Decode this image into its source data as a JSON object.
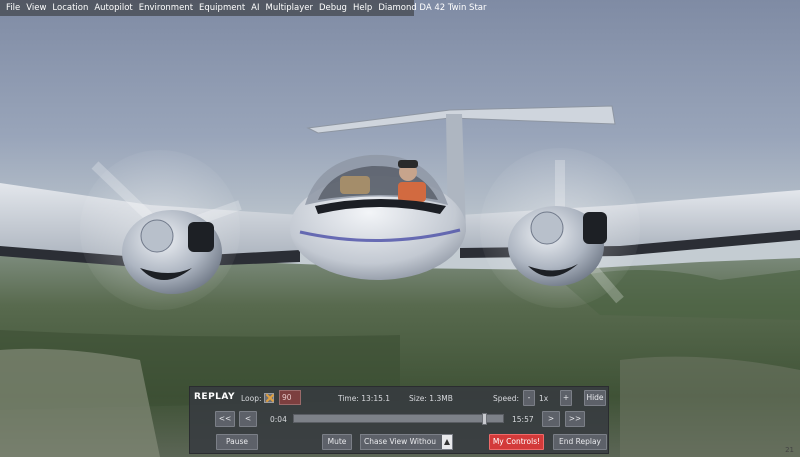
{
  "menu": {
    "items": [
      "File",
      "View",
      "Location",
      "Autopilot",
      "Environment",
      "Equipment",
      "AI",
      "Multiplayer",
      "Debug",
      "Help",
      "Diamond DA 42 Twin Star"
    ]
  },
  "replay": {
    "title": "REPLAY",
    "loop_label": "Loop:",
    "loop_checked": true,
    "loop_value": "90",
    "time_text": "Time: 13:15.1",
    "size_text": "Size: 1.3MB",
    "speed_label": "Speed:",
    "speed_minus": "-",
    "speed_value": "1x",
    "speed_plus": "+",
    "hide_label": "Hide",
    "rewind_fast": "<<",
    "rewind": "<",
    "start_time": "0:04",
    "end_time": "15:57",
    "position_fraction": 0.92,
    "forward": ">",
    "forward_fast": ">>",
    "pause_label": "Pause",
    "mute_label": "Mute",
    "view_select": "Chase View Withou",
    "my_controls_label": "My Controls!",
    "end_replay_label": "End Replay"
  },
  "hud": {
    "fps": "21"
  },
  "colors": {
    "menu_bg": "#464a52",
    "dialog_bg": "#373a40",
    "my_controls": "#d33a3a"
  }
}
